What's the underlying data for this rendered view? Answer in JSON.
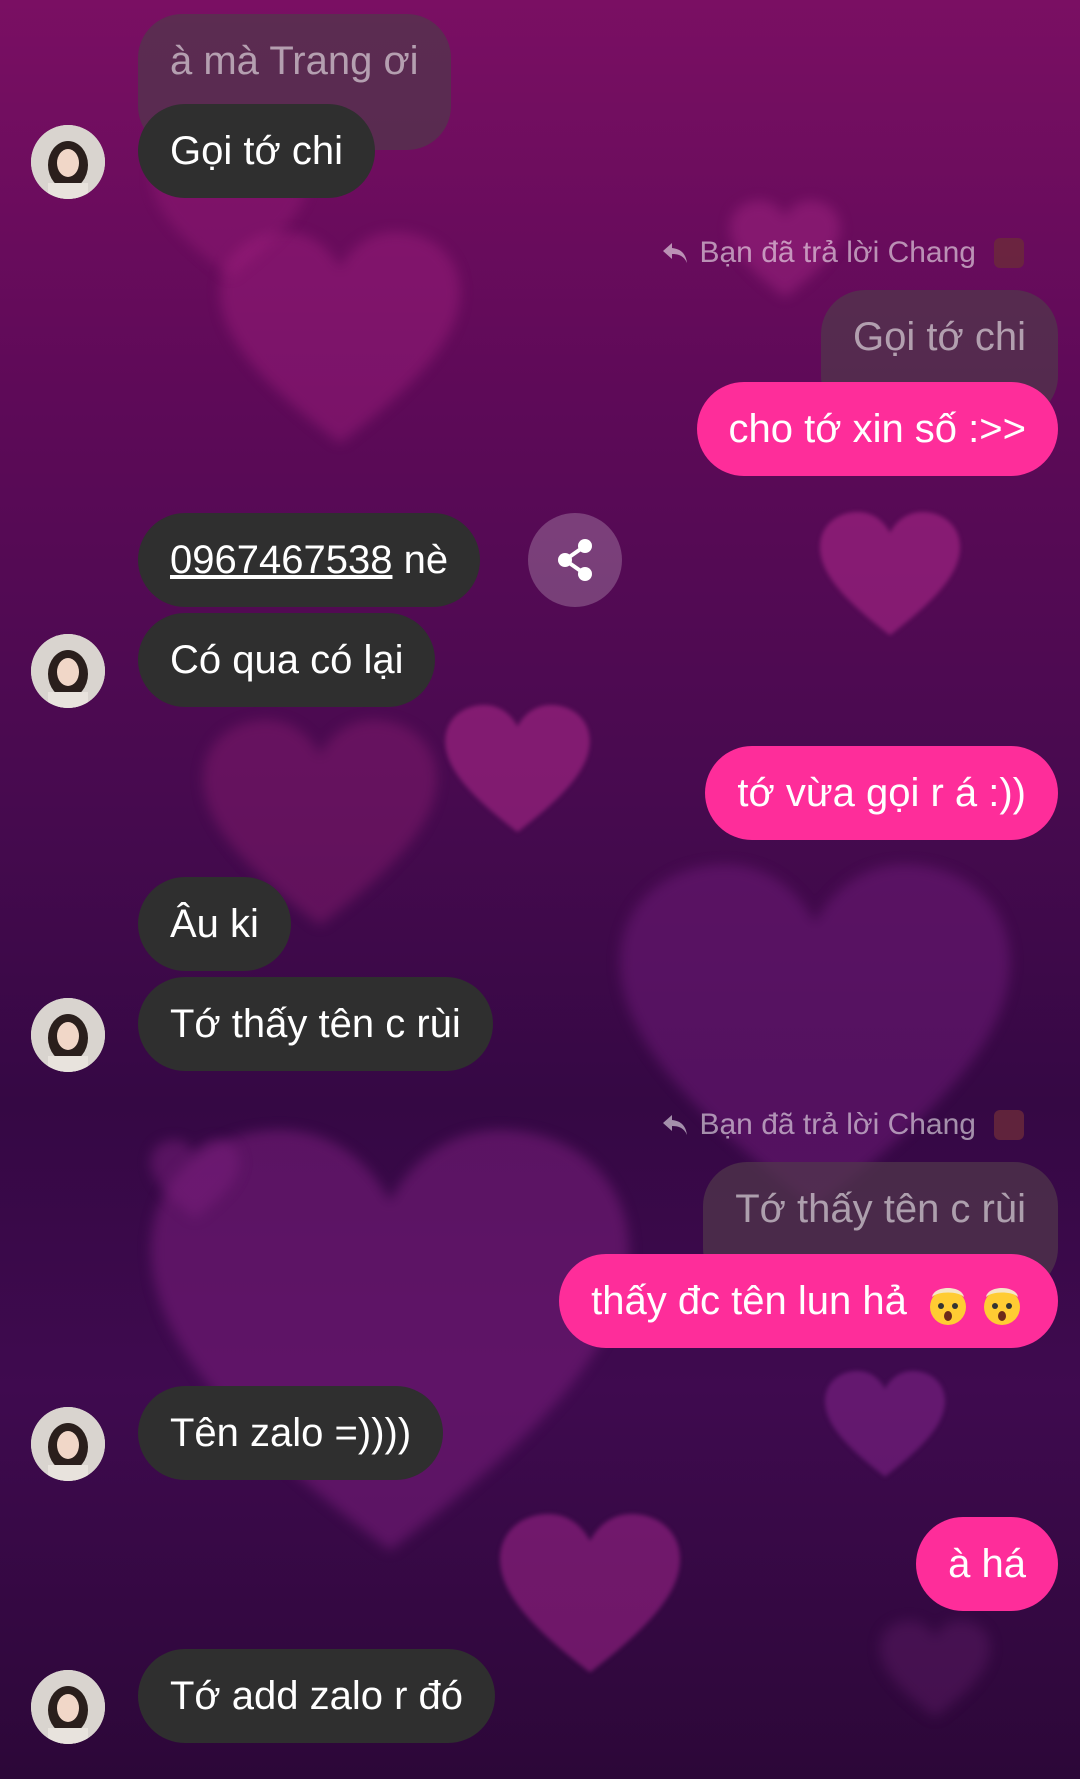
{
  "chat": {
    "q1": "à mà Trang ơi",
    "m1": "Gọi tớ chi",
    "reply_label_1": "Bạn đã trả lời Chang",
    "q2": "Gọi tớ chi",
    "m2": "cho tớ xin số :>>",
    "m3_phone": "0967467538",
    "m3_rest": " nè",
    "m4": "Có qua có lại",
    "m5": "tớ vừa gọi r á :))",
    "m6": "Âu ki",
    "m7": "Tớ thấy tên c rùi",
    "reply_label_2": "Bạn đã trả lời Chang",
    "q3": "Tớ thấy tên c rùi",
    "m8": "thấy đc tên lun hả",
    "m9": "Tên zalo =))))",
    "m10": "à há",
    "m11": "Tớ add zalo r đó"
  },
  "icons": {
    "reply": "reply-arrow-icon",
    "share": "share-icon",
    "emoji": "exploding-head-emoji"
  },
  "colors": {
    "sent_bubble": "#fe2d9a",
    "received_bubble": "#2f2f2f",
    "background_top": "#7a0f63",
    "background_bottom": "#2c0738"
  }
}
